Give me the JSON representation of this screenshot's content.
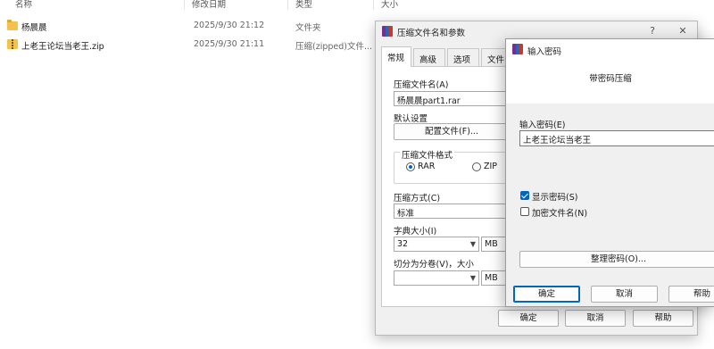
{
  "explorer": {
    "columns": [
      "名称",
      "修改日期",
      "类型",
      "大小"
    ],
    "files": [
      {
        "name": "杨晨晨",
        "date": "2025/9/30 21:12",
        "type": "文件夹",
        "icon": "folder-icon"
      },
      {
        "name": "上老王论坛当老王.zip",
        "date": "2025/9/30 21:11",
        "type": "压缩(zipped)文件...",
        "icon": "zip-icon"
      }
    ]
  },
  "rar_dialog": {
    "title": "压缩文件名和参数",
    "help_glyph": "?",
    "close_glyph": "✕",
    "tabs": [
      "常规",
      "高级",
      "选项",
      "文件"
    ],
    "archive_name_label": "压缩文件名(A)",
    "archive_name_value": "杨晨晨part1.rar",
    "default_profile_label": "默认设置",
    "profiles_button": "配置文件(F)...",
    "format_label": "压缩文件格式",
    "format_options": [
      "RAR",
      "ZIP"
    ],
    "format_selected": "RAR",
    "method_label": "压缩方式(C)",
    "method_value": "标准",
    "dict_label": "字典大小(I)",
    "dict_value": "32",
    "dict_unit": "MB",
    "split_label": "切分为分卷(V)，大小",
    "split_value": "",
    "split_unit": "MB",
    "ok_button": "确定",
    "cancel_button": "取消",
    "help_button": "帮助"
  },
  "pwd_dialog": {
    "title": "输入密码",
    "header": "带密码压缩",
    "password_label": "输入密码(E)",
    "password_value": "上老王论坛当老王",
    "show_password_label": "显示密码(S)",
    "show_password_checked": true,
    "encrypt_names_label": "加密文件名(N)",
    "encrypt_names_checked": false,
    "organize_button": "整理密码(O)...",
    "ok_button": "确定",
    "cancel_button": "取消",
    "help_button": "帮助"
  },
  "colors": {
    "accent": "#0067c0",
    "folder": "#f2c14e",
    "dialog_bg": "#f0f0f0"
  }
}
